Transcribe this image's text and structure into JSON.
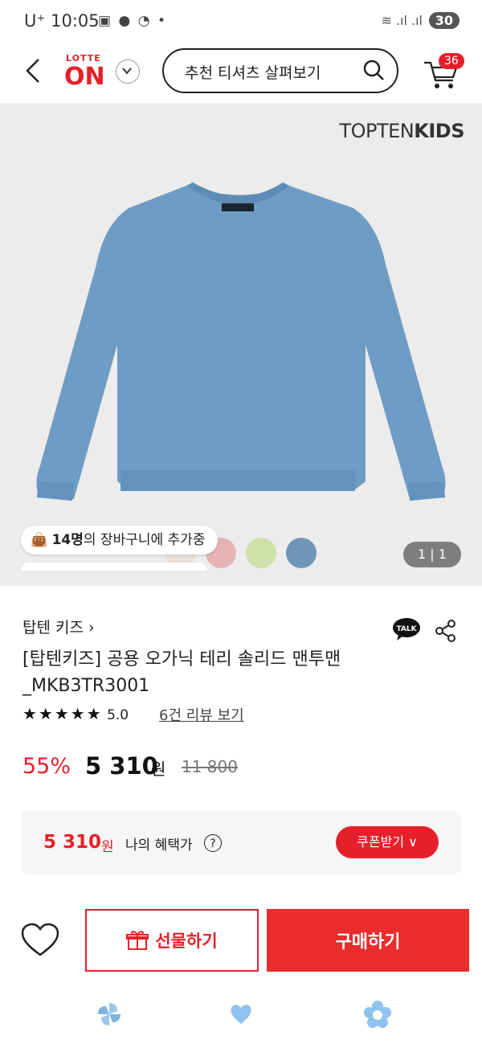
{
  "status_bar": {
    "carrier": "U⁺ 10:05",
    "battery": "30"
  },
  "header": {
    "logo_top": "LOTTE",
    "logo_bottom": "ON",
    "search_text": "추천 티셔츠 살펴보기",
    "cart_count": "36"
  },
  "gallery": {
    "brand_prefix": "TOPTEN",
    "brand_suffix": "KIDS",
    "counter": "1 | 1",
    "cart_count_bold": "14명",
    "cart_text": "의 장바구니에 추가중",
    "swatches": [
      "#e8d5cc",
      "#e5b3b3",
      "#cfe0a8",
      "#6f96b9"
    ]
  },
  "product": {
    "brand_link": "탑텐 키즈 ›",
    "title": "[탑텐키즈] 공용 오가닉 테리 솔리드 맨투맨_MKB3TR3001",
    "stars": "★★★★★",
    "rating": "5.0",
    "review_link": "6건 리뷰 보기",
    "discount": "55%",
    "price": "5 310",
    "price_unit": "원",
    "original_price": "11 800"
  },
  "benefit": {
    "price": "5 310",
    "unit": "원",
    "label": "나의 혜택가",
    "help": "?",
    "coupon_button": "쿠폰받기 ∨"
  },
  "actions": {
    "gift_button": "선물하기",
    "buy_button": "구매하기"
  },
  "colors": {
    "accent": "#e6202a",
    "sweatshirt": "#6f9cc4"
  }
}
